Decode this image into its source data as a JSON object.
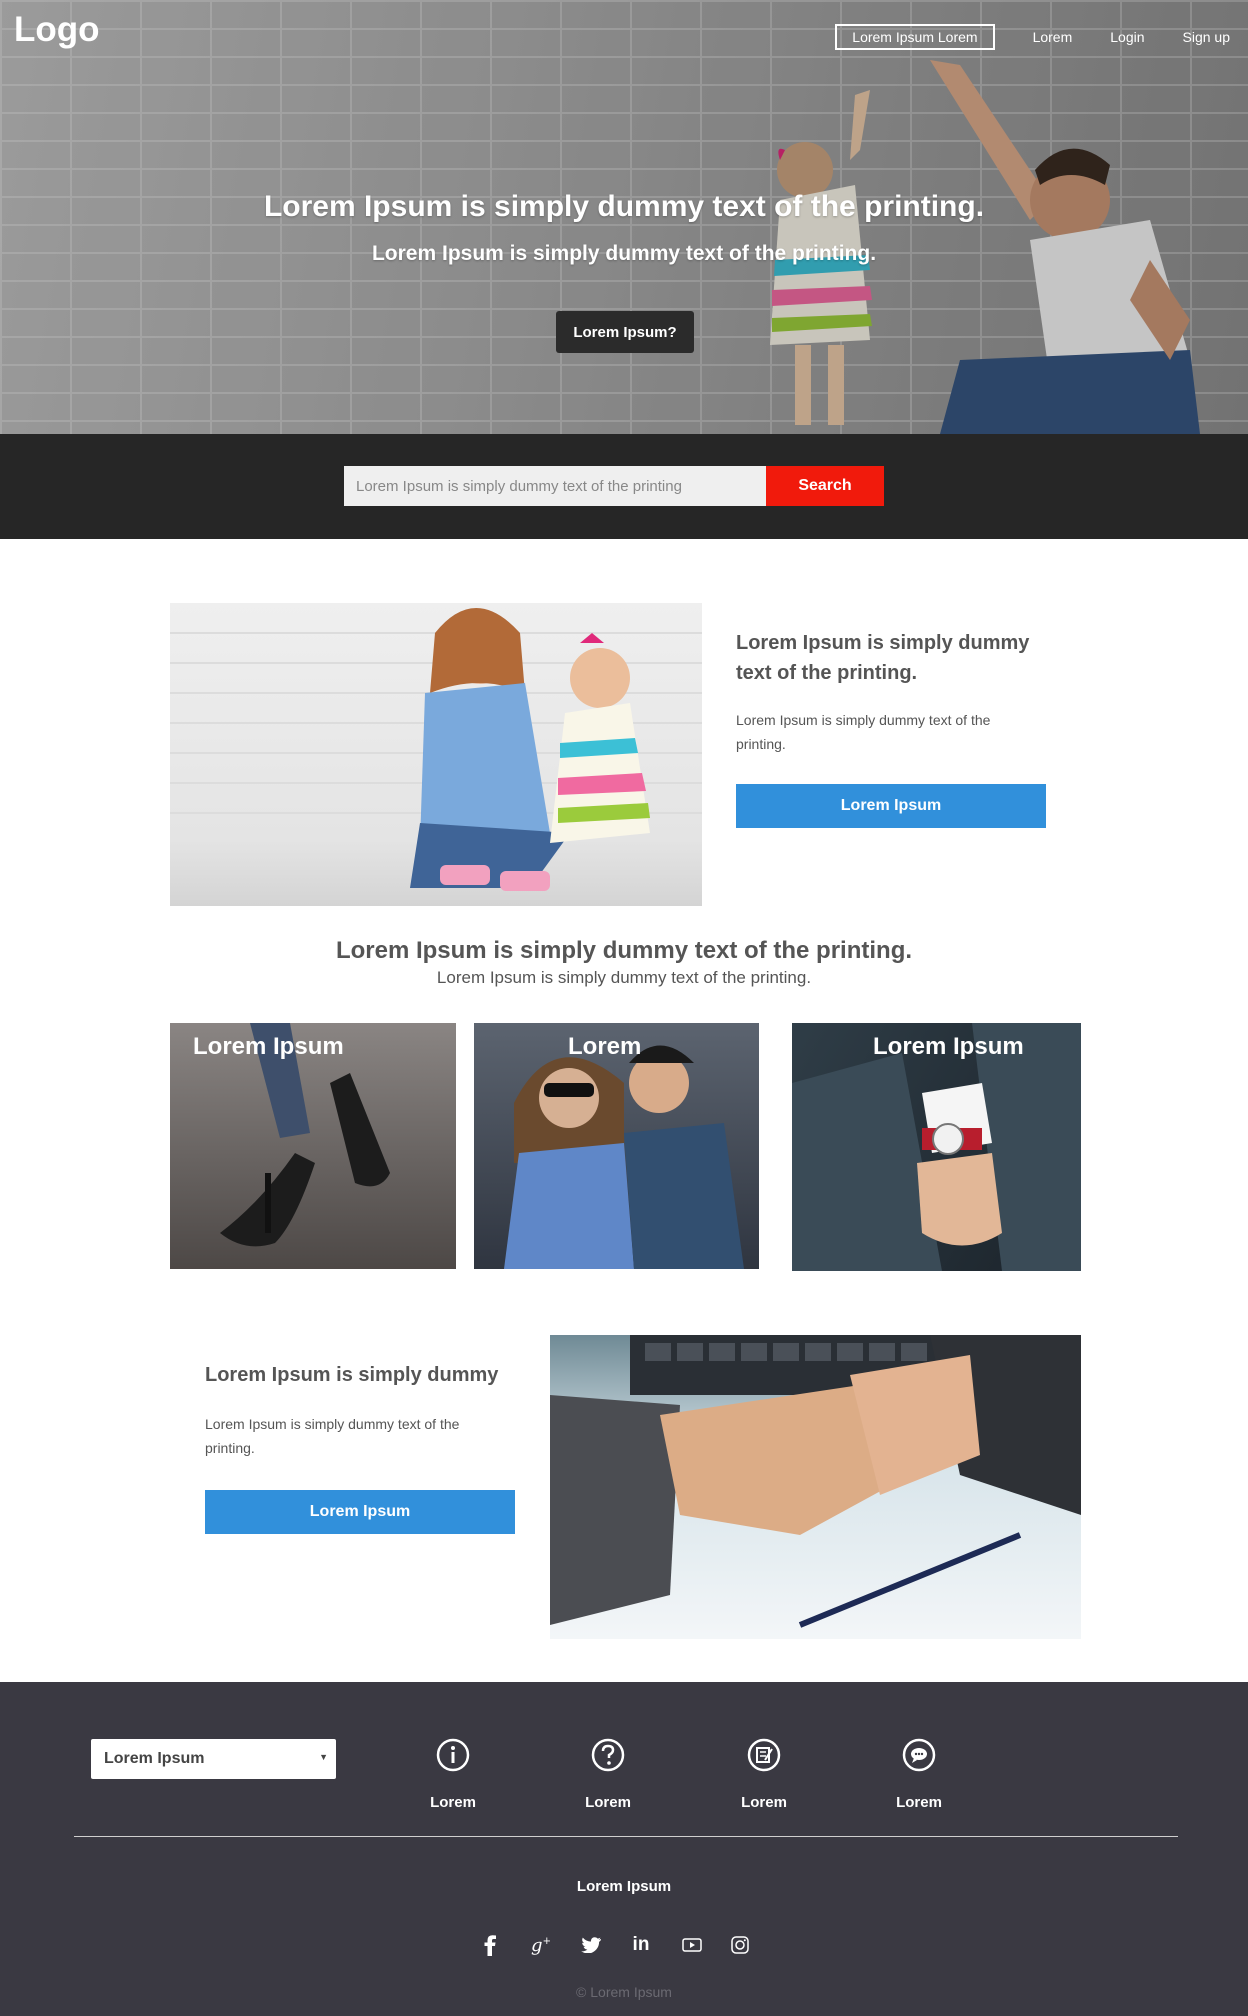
{
  "header": {
    "logo": "Logo",
    "nav": [
      "Lorem Ipsum Lorem",
      "Lorem",
      "Login",
      "Sign up"
    ]
  },
  "hero": {
    "title": "Lorem Ipsum is simply dummy text of the printing.",
    "subtitle": "Lorem Ipsum is simply dummy text of the printing.",
    "button": "Lorem Ipsum?"
  },
  "search": {
    "placeholder": "Lorem Ipsum is simply dummy text of the printing",
    "button": "Search"
  },
  "feature1": {
    "title": "Lorem Ipsum is simply dummy text of the printing.",
    "text": "Lorem Ipsum is simply dummy text of the printing.",
    "button": "Lorem Ipsum"
  },
  "section2": {
    "title": "Lorem Ipsum is simply dummy text of the printing.",
    "subtitle": "Lorem Ipsum is simply dummy text of the printing.",
    "cards": [
      {
        "label": "Lorem Ipsum"
      },
      {
        "label": "Lorem"
      },
      {
        "label": "Lorem Ipsum"
      }
    ]
  },
  "feature2": {
    "title": "Lorem Ipsum is simply dummy",
    "text": "Lorem Ipsum is simply dummy text of the printing.",
    "button": "Lorem Ipsum"
  },
  "footer": {
    "select_value": "Lorem Ipsum",
    "links": [
      {
        "icon": "info-icon",
        "label": "Lorem"
      },
      {
        "icon": "question-icon",
        "label": "Lorem"
      },
      {
        "icon": "edit-icon",
        "label": "Lorem"
      },
      {
        "icon": "chat-icon",
        "label": "Lorem"
      }
    ],
    "brand": "Lorem Ipsum",
    "social": [
      "facebook-icon",
      "google-plus-icon",
      "twitter-icon",
      "linkedin-icon",
      "youtube-icon",
      "instagram-icon"
    ],
    "copyright": "© Lorem Ipsum"
  },
  "colors": {
    "accent_blue": "#3190db",
    "search_red": "#f11a0c",
    "footer_bg": "#3a3942",
    "search_band": "#262626"
  }
}
